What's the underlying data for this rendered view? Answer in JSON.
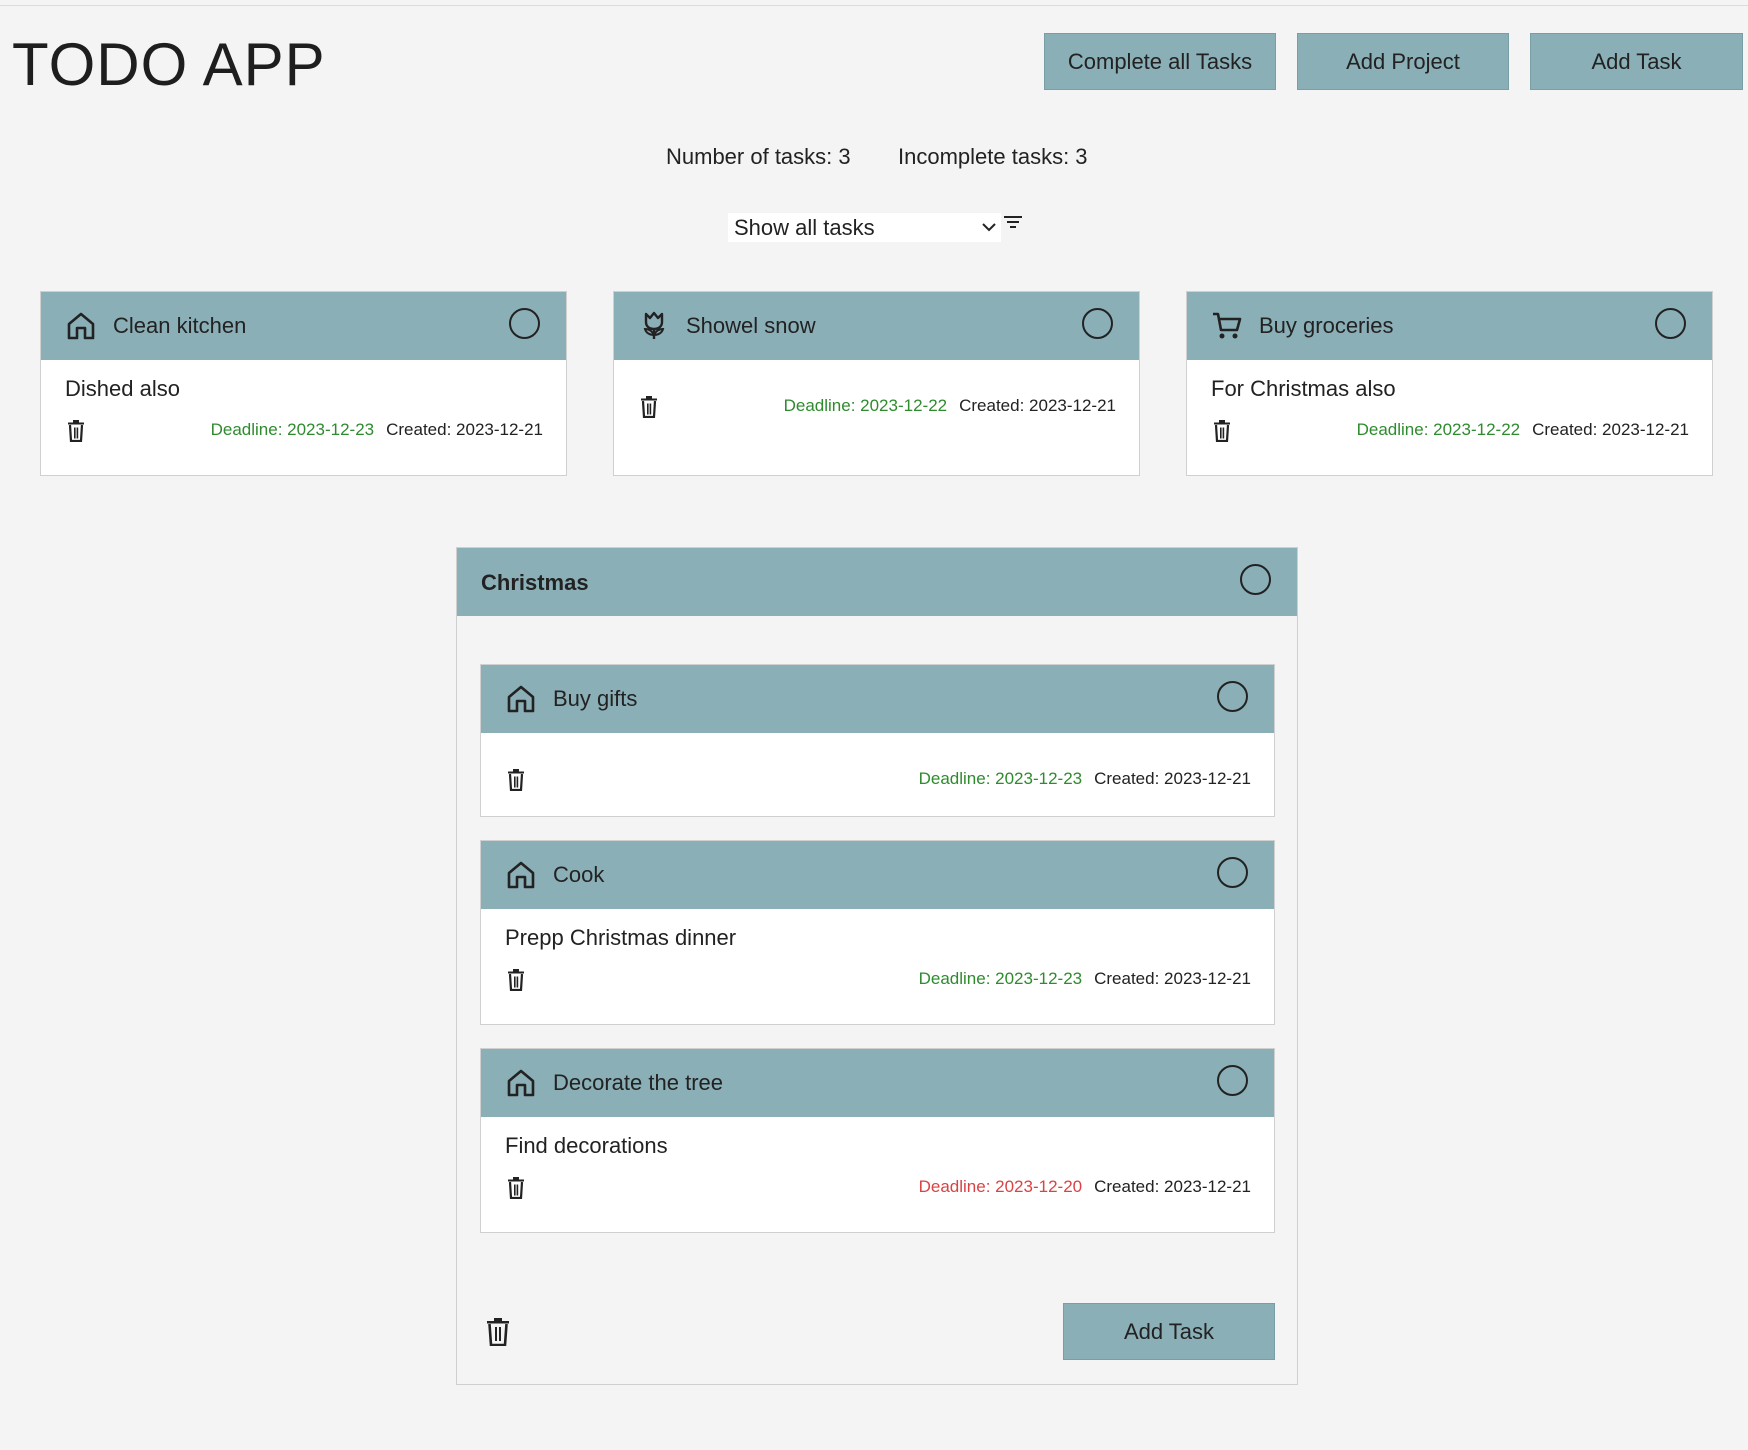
{
  "app": {
    "title": "TODO APP"
  },
  "toolbar": {
    "complete_all_label": "Complete all Tasks",
    "add_project_label": "Add Project",
    "add_task_label": "Add Task"
  },
  "stats": {
    "total_text": "Number of tasks: 3",
    "incomplete_text": "Incomplete tasks: 3"
  },
  "filter": {
    "selected": "Show all tasks",
    "icon": "filter-icon"
  },
  "colors": {
    "header": "#8aafb7",
    "deadline_ok": "#2e8b2e",
    "deadline_overdue": "#d94343",
    "background": "#f4f4f4"
  },
  "tasks": [
    {
      "title": "Clean kitchen",
      "icon": "home-icon",
      "description": "Dished also",
      "deadline": "Deadline: 2023-12-23",
      "created": "Created: 2023-12-21",
      "overdue": false
    },
    {
      "title": "Showel snow",
      "icon": "flower-icon",
      "description": "",
      "deadline": "Deadline: 2023-12-22",
      "created": "Created: 2023-12-21",
      "overdue": false
    },
    {
      "title": "Buy groceries",
      "icon": "cart-icon",
      "description": "For Christmas also",
      "deadline": "Deadline: 2023-12-22",
      "created": "Created: 2023-12-21",
      "overdue": false
    }
  ],
  "project": {
    "title": "Christmas",
    "add_task_label": "Add Task",
    "tasks": [
      {
        "title": "Buy gifts",
        "icon": "home-icon",
        "description": "",
        "deadline": "Deadline: 2023-12-23",
        "created": "Created: 2023-12-21",
        "overdue": false
      },
      {
        "title": "Cook",
        "icon": "home-icon",
        "description": "Prepp Christmas dinner",
        "deadline": "Deadline: 2023-12-23",
        "created": "Created: 2023-12-21",
        "overdue": false
      },
      {
        "title": "Decorate the tree",
        "icon": "home-icon",
        "description": "Find decorations",
        "deadline": "Deadline: 2023-12-20",
        "created": "Created: 2023-12-21",
        "overdue": true
      }
    ]
  }
}
